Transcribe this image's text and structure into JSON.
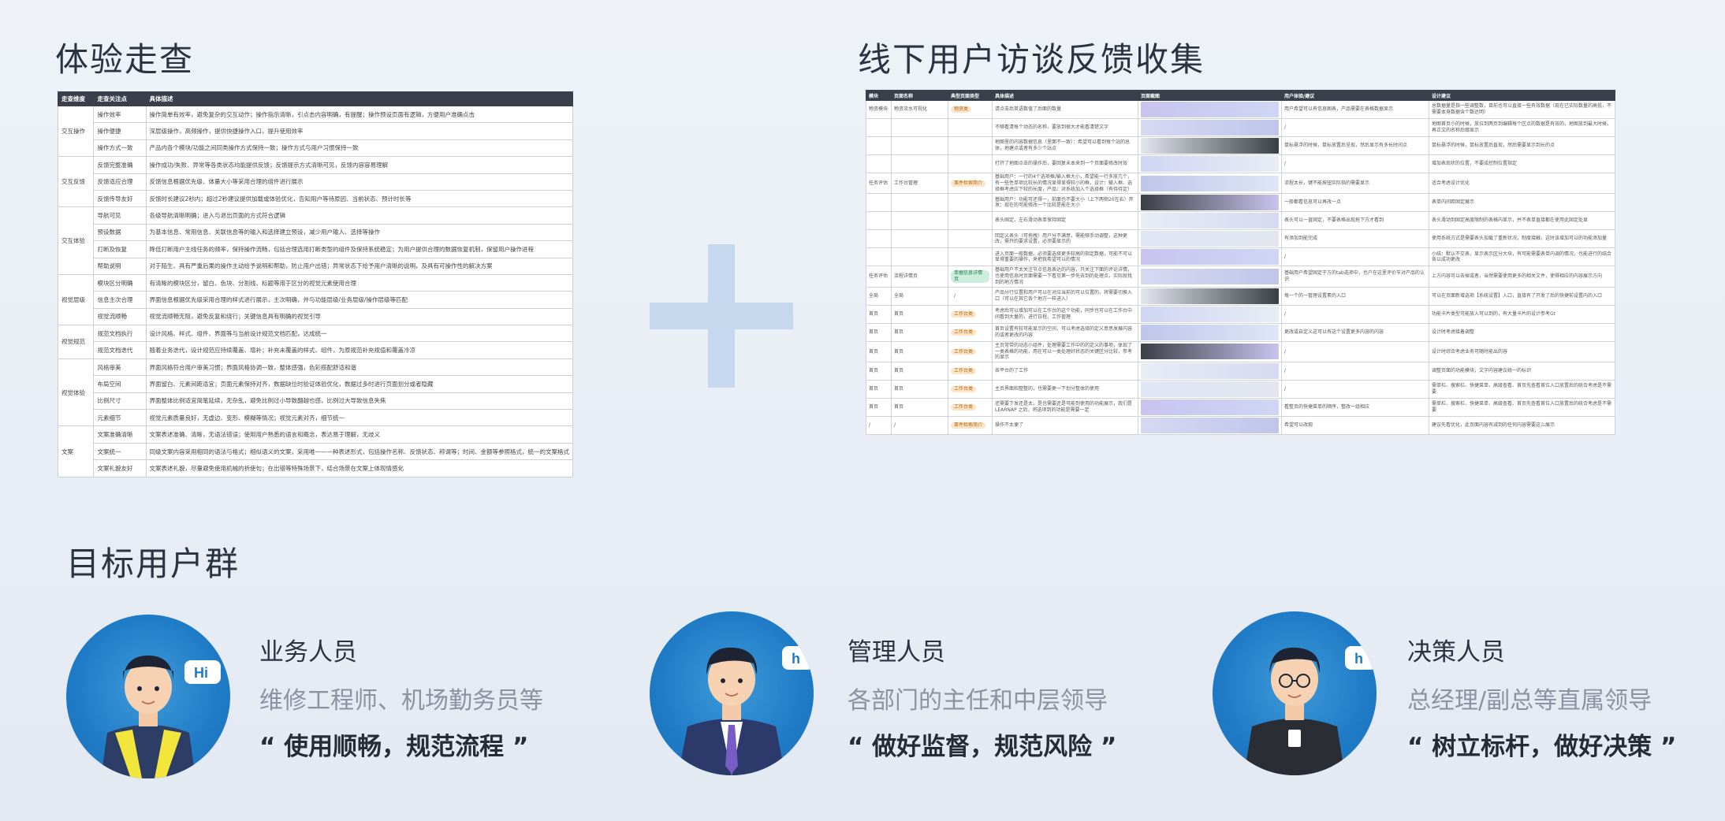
{
  "sections": {
    "walkthrough_title": "体验走查",
    "interview_title": "线下用户访谈反馈收集",
    "users_title": "目标用户群"
  },
  "walkthrough_table": {
    "headers": [
      "走查维度",
      "走查关注点",
      "具体描述"
    ],
    "rows": [
      {
        "dim": "交互操作",
        "point": "操作效率",
        "desc": "操作简单有效率，避免复杂的交互动作；操作指示清晰，引点击内容明确，有提醒；操作预设页面有逻辑，方便用户准确点击"
      },
      {
        "dim": "",
        "point": "操作便捷",
        "desc": "深层级操作，高频操作，提供快捷操作入口，提升使用效率"
      },
      {
        "dim": "",
        "point": "操作方式一致",
        "desc": "产品内各个模块/功能之间同类操作方式保持一致；操作方式与用户习惯保持一致"
      },
      {
        "dim": "交互反馈",
        "point": "反馈完整准确",
        "desc": "操作成功/失败、异常等各类状态均能提供反馈；反馈提示方式清晰可见，反馈内容容易理解"
      },
      {
        "dim": "",
        "point": "反馈适应合理",
        "desc": "反馈信息根据优先级、体量大小等采用合理的组件进行展示"
      },
      {
        "dim": "",
        "point": "反馈传导友好",
        "desc": "反馈时长建议2秒内；超过2秒建议提供加载或体验优化，告知用户等待原因、当前状态、预计时长等"
      },
      {
        "dim": "交互体验",
        "point": "导航可见",
        "desc": "各级导航清晰明确；进入与退出页面的方式符合逻辑"
      },
      {
        "dim": "",
        "point": "预设数据",
        "desc": "为基本信息、常用信息、关联信息等的输入和选择建立预设，减少用户输入、选择等操作"
      },
      {
        "dim": "",
        "point": "打断及恢复",
        "desc": "降低打断用户主线任务的频率，保持操作流畅，包括合理选用打断类型的组件及保持系统稳定；为用户提供合理的数据恢复机制，保留用户操作进程"
      },
      {
        "dim": "",
        "point": "帮助说明",
        "desc": "对于陌生、具有严重后果的操作主动给予说明和帮助，防止用户出错；异常状态下给予用户清晰的说明，及具有可操作性的解决方案"
      },
      {
        "dim": "视觉层级",
        "point": "模块区分明确",
        "desc": "有清晰的模块区分，留白、色块、分割线、标题等用于区分的视觉元素使用合理"
      },
      {
        "dim": "",
        "point": "信息主次合理",
        "desc": "界面信息根据优先级采用合理的样式进行展示，主次明确，并与功能层级/业务层级/操作层级等匹配"
      },
      {
        "dim": "",
        "point": "视觉流顺畅",
        "desc": "视觉流顺畅无阻，避免反复和绕行；关键信息具有明确的视觉引导"
      },
      {
        "dim": "视觉规范",
        "point": "规范文档执行",
        "desc": "设计风格、样式、组件、界面等与当前设计规范文档匹配，达成统一"
      },
      {
        "dim": "",
        "point": "规范文档迭代",
        "desc": "随着业务迭代，设计规范应持续覆盖、增补；补充未覆盖的样式、组件，为原规范补充规值和覆盖冷凉"
      },
      {
        "dim": "视觉体验",
        "point": "风格审美",
        "desc": "界面风格符合用户审美习惯；界面风格协调一致，整体感强，色彩搭配舒适和谐"
      },
      {
        "dim": "",
        "point": "布局空间",
        "desc": "界面留白、元素间距适宜；页面元素保持对齐，数据缺位时验证体验优化，数据过多时进行页面划分或者隐藏"
      },
      {
        "dim": "",
        "point": "比例尺寸",
        "desc": "界面整体比例适宜简笔延续，无杂乱，避免比例过小导致翻越也感，比例过大导致信息失焦"
      },
      {
        "dim": "",
        "point": "元素细节",
        "desc": "视觉元素质量良好，无虚边、变形、模糊等情况；视觉元素对齐，细节统一"
      },
      {
        "dim": "文案",
        "point": "文案准确清晰",
        "desc": "文案表述准确、清晰，无语法错误；使用用户熟悉的语言和概念，表达易于理解，无歧义"
      },
      {
        "dim": "",
        "point": "文案统一",
        "desc": "同级文案内容采用相同的语法与格式；相似语义的文案，采用唯一——种表述形式，包括操作名称、反馈状态、称谓等；时间、金额等参照格式，统一的文案格式"
      },
      {
        "dim": "",
        "point": "文案礼貌友好",
        "desc": "文案表述礼貌，尽量避免使用机械的祈使句；在出错等特殊场景下，结合场景在文案上体现情感化"
      }
    ]
  },
  "interview_table": {
    "headers": [
      "模块",
      "页面名称",
      "典型页面类型",
      "具体描述",
      "页面截图",
      "用户体验/建议",
      "设计建议"
    ],
    "rows": [
      {
        "m": "物资模块",
        "p": "物资流水可视化",
        "t": "物资类",
        "tc": "o",
        "d": "请点击后英语数值了后面的数量",
        "u": "用户希望可以有信息图表，产品需要在表格数据显示",
        "s": "总数据量是指一些调整数，目前也可以直接一些有效数据（现在已实际数量的高低，不需要本身数据含个数达明）"
      },
      {
        "m": "",
        "p": "",
        "t": "",
        "tc": "",
        "d": "不够看清每个动态的名称，要放到很大才能看清楚文字",
        "u": "/",
        "s": "地图首页小的时候，放拉到两页到编辑每个区点的数据是有效的，地图放到最大时候，再正文的名称后缀显示"
      },
      {
        "m": "",
        "p": "",
        "t": "",
        "tc": "",
        "d": "地图里的内容数据信息（里面不一致）：希望可以看到每个站的总体，地建点或者有多少个站点",
        "u": "鼠标悬浮的时候，鼠标放置后呈现，然后显示有多长时间点",
        "s": "鼠标悬浮的时候，鼠标放置后直现，然后需要显示到长的点"
      },
      {
        "m": "",
        "p": "",
        "t": "",
        "tc": "",
        "d": "打开了地图点击的操作后，要回复未本来到一个页面要修改时效",
        "u": "/",
        "s": "增加表现状的位置，不要成控制位置指定"
      },
      {
        "m": "任务评估",
        "p": "工作台管理",
        "t": "事件检索简介",
        "tc": "o",
        "d": "基础用户：一行的4个选项框/输入框大小，希望能一行多放几个，有一些性单项比较长的情况显得显得较小的框，设计：输入框、选择框考虑应下较的长度，产品：对系统加入个选择框（有待待定）",
        "u": "流程太长，键不能按钮实际指的需要显示",
        "s": "适合考虑设计优化"
      },
      {
        "m": "",
        "p": "",
        "t": "",
        "tc": "",
        "d": "基础用户：功能可还得一，前面也不要大小（上下两侧20左右）开发：现在的可能修改一个比较是能在大小",
        "u": "一般都看信息可以再改一点",
        "s": "表单内间距固定展示"
      },
      {
        "m": "",
        "p": "",
        "t": "",
        "tc": "",
        "d": "表头固定，左右滑动表单保持固定",
        "u": "表头可以一直固定，不要表格出现拖下方才看到",
        "s": "表头滑动到固定高度限制的表格内显示，并不表单直接都在使用此固定处显"
      },
      {
        "m": "",
        "p": "",
        "t": "",
        "tc": "",
        "d": "回定义表头（可拖拽）用户分不满意，需能够手动调整，这种更改，需开的要求设置，必须要显示的",
        "u": "有添加到能完成",
        "s": "使用系统方式是需要表头加载了重新状况，制度接触，这时该增加可以的功能添加量"
      },
      {
        "m": "",
        "p": "",
        "t": "",
        "tc": "",
        "d": "进入页面一般数据，必须要选择更多较高的指定数据，可能不可以显得重要的操作，来把我希望可以的情况",
        "u": "/",
        "s": "小结：默认不交表，显示表示区分大块，有可能需要表单内调的情况，也能进行的结合各以成功更改"
      },
      {
        "m": "任务评估",
        "p": "流程详情页",
        "t": "单据信息详情页",
        "tc": "g",
        "d": "基础用户不太关注节点信息表达的内容，只关注下面的评论详情，也使用信息时页面需要一下看见第一步先去到的处理点，实际就找到的地方情况",
        "u": "基础用户希望固定于方的tab选项中，也户在这里评价节对产品的认识",
        "s": "上方内容可以去掉或者，当然需要使用更多的相关文件，使得相应的内容展示方向"
      },
      {
        "m": "全局",
        "p": "全局",
        "t": "/",
        "tc": "",
        "d": "产品分行位置和用户可以在对应当前的可以位置的，将需要切换入口（可以在其它各个地方一样进入）",
        "u": "每一个的一管理设置素的入口",
        "s": "可以在页面新增选项【系统设置】入口，直接有了开发了后的快捷前设置内的入口"
      },
      {
        "m": "首页",
        "p": "首页",
        "t": "工作台类",
        "tc": "o",
        "d": "考虑后可以增加可以在工作台的这个功能，同步也可以在工作台中间看到大量的，进行日程，工作管理",
        "u": "/",
        "s": "功能卡片类型可能放入可以到的，有大量卡片的设计参考Gt"
      },
      {
        "m": "首页",
        "p": "首页",
        "t": "工作台类",
        "tc": "o",
        "d": "首页设置有较可能显示的空间，可以考虑选择的定义意思发展内容的或者更改的内容",
        "u": "更改或自定义这可以有这个设置更多内容的内容",
        "s": "设计时考虑接着调整"
      },
      {
        "m": "首页",
        "p": "首页",
        "t": "工作台类",
        "tc": "o",
        "d": "主页常带的动态小组件，处理需要工作中的的定义的事项，体现了一类表格的功能，用在可以一类处理好状态的关键区分比较，参考的显示",
        "u": "/",
        "s": "设计时综合考虑业务可随时能出的容"
      },
      {
        "m": "首页",
        "p": "首页",
        "t": "工作台类",
        "tc": "o",
        "d": "各平台的了工作",
        "u": "/",
        "s": "调整页面的功能模块，文字内容建议统一的标识"
      },
      {
        "m": "首页",
        "p": "首页",
        "t": "工作台类",
        "tc": "o",
        "d": "主页界面和整整的，也需要更一下划分整体的使用",
        "u": "/",
        "s": "需单栏、搜索栏、快捷菜单、高级查看、首页先查看首位入口放置后的统合考虑是不需要"
      },
      {
        "m": "首页",
        "p": "首页",
        "t": "工作台类",
        "tc": "o",
        "d": "还需要下发还是太，是也需要还是可能到使用的功能展示，我们是LEARNAP 之后，将选项到的功能是需要一定",
        "u": "看整页的快捷菜单的顺序，整改一组相应",
        "s": "需单栏、搜索栏、快捷菜单、高级查看、首页先查看首位入口放置后的统合考虑是不需要"
      },
      {
        "m": "/",
        "p": "/",
        "t": "事件检索简介",
        "tc": "o",
        "d": "操作不太便了",
        "u": "希望可以改观",
        "s": "建议先看优化，此页面内容有减到的任何内容需要这么展示"
      }
    ]
  },
  "personas": [
    {
      "role": "业务人员",
      "desc": "维修工程师、机场勤务员等",
      "quote": "“ 使用顺畅，规范流程 ”",
      "bubble": "Hi"
    },
    {
      "role": "管理人员",
      "desc": "各部门的主任和中层领导",
      "quote": "“ 做好监督，规范风险 ”",
      "bubble": "h"
    },
    {
      "role": "决策人员",
      "desc": "总经理/副总等直属领导",
      "quote": "“ 树立标杆，做好决策 ”",
      "bubble": "h"
    }
  ],
  "colors": {
    "accent": "#1f7bc6",
    "plus": "#c6d8ee",
    "header": "#3a3f4b"
  }
}
